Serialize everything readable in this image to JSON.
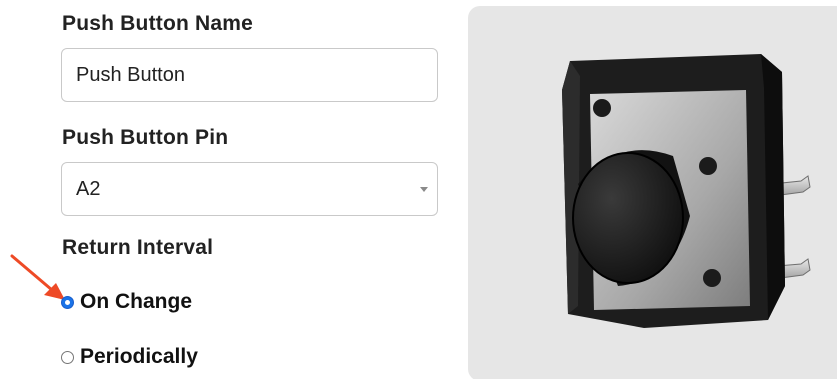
{
  "form": {
    "name_label": "Push Button Name",
    "name_value": "Push Button",
    "pin_label": "Push Button Pin",
    "pin_value": "A2",
    "interval_label": "Return Interval",
    "options": [
      {
        "label": "On Change",
        "selected": true
      },
      {
        "label": "Periodically",
        "selected": false
      }
    ]
  },
  "colors": {
    "accent": "#1a73e8",
    "annotation_arrow": "#ee4a26",
    "panel_bg": "#e6e6e6"
  },
  "icons": {
    "pin_select": "chevron-down-icon",
    "annotation": "red-arrow-icon"
  }
}
